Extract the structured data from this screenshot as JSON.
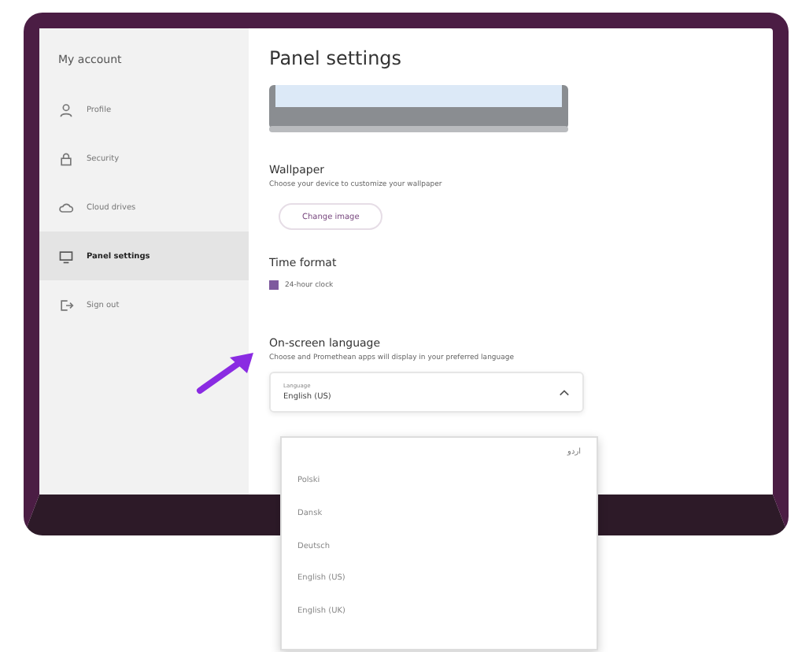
{
  "sidebar": {
    "title": "My account",
    "items": [
      {
        "label": "Profile",
        "kind": "person",
        "selected": false
      },
      {
        "label": "Security",
        "kind": "lock",
        "selected": false
      },
      {
        "label": "Cloud drives",
        "kind": "cloud",
        "selected": false
      },
      {
        "label": "Panel settings",
        "kind": "panel",
        "selected": true
      },
      {
        "label": "Sign out",
        "kind": "exit",
        "selected": false
      }
    ]
  },
  "content": {
    "title": "Panel settings",
    "wallpaper": {
      "title": "Wallpaper",
      "description": "Choose your device to customize your wallpaper",
      "button": "Change image"
    },
    "time_format": {
      "title": "Time format",
      "option": {
        "label": "24-hour clock",
        "checked": true
      }
    },
    "language": {
      "title": "On-screen language",
      "description": "Choose and Promethean apps will display in your preferred language",
      "dropdown": {
        "label": "Language",
        "value": "English (US)",
        "expanded": true,
        "list_header": "اردو",
        "options": [
          "Polski",
          "Dansk",
          "Deutsch",
          "English (US)",
          "English (UK)"
        ]
      }
    }
  }
}
